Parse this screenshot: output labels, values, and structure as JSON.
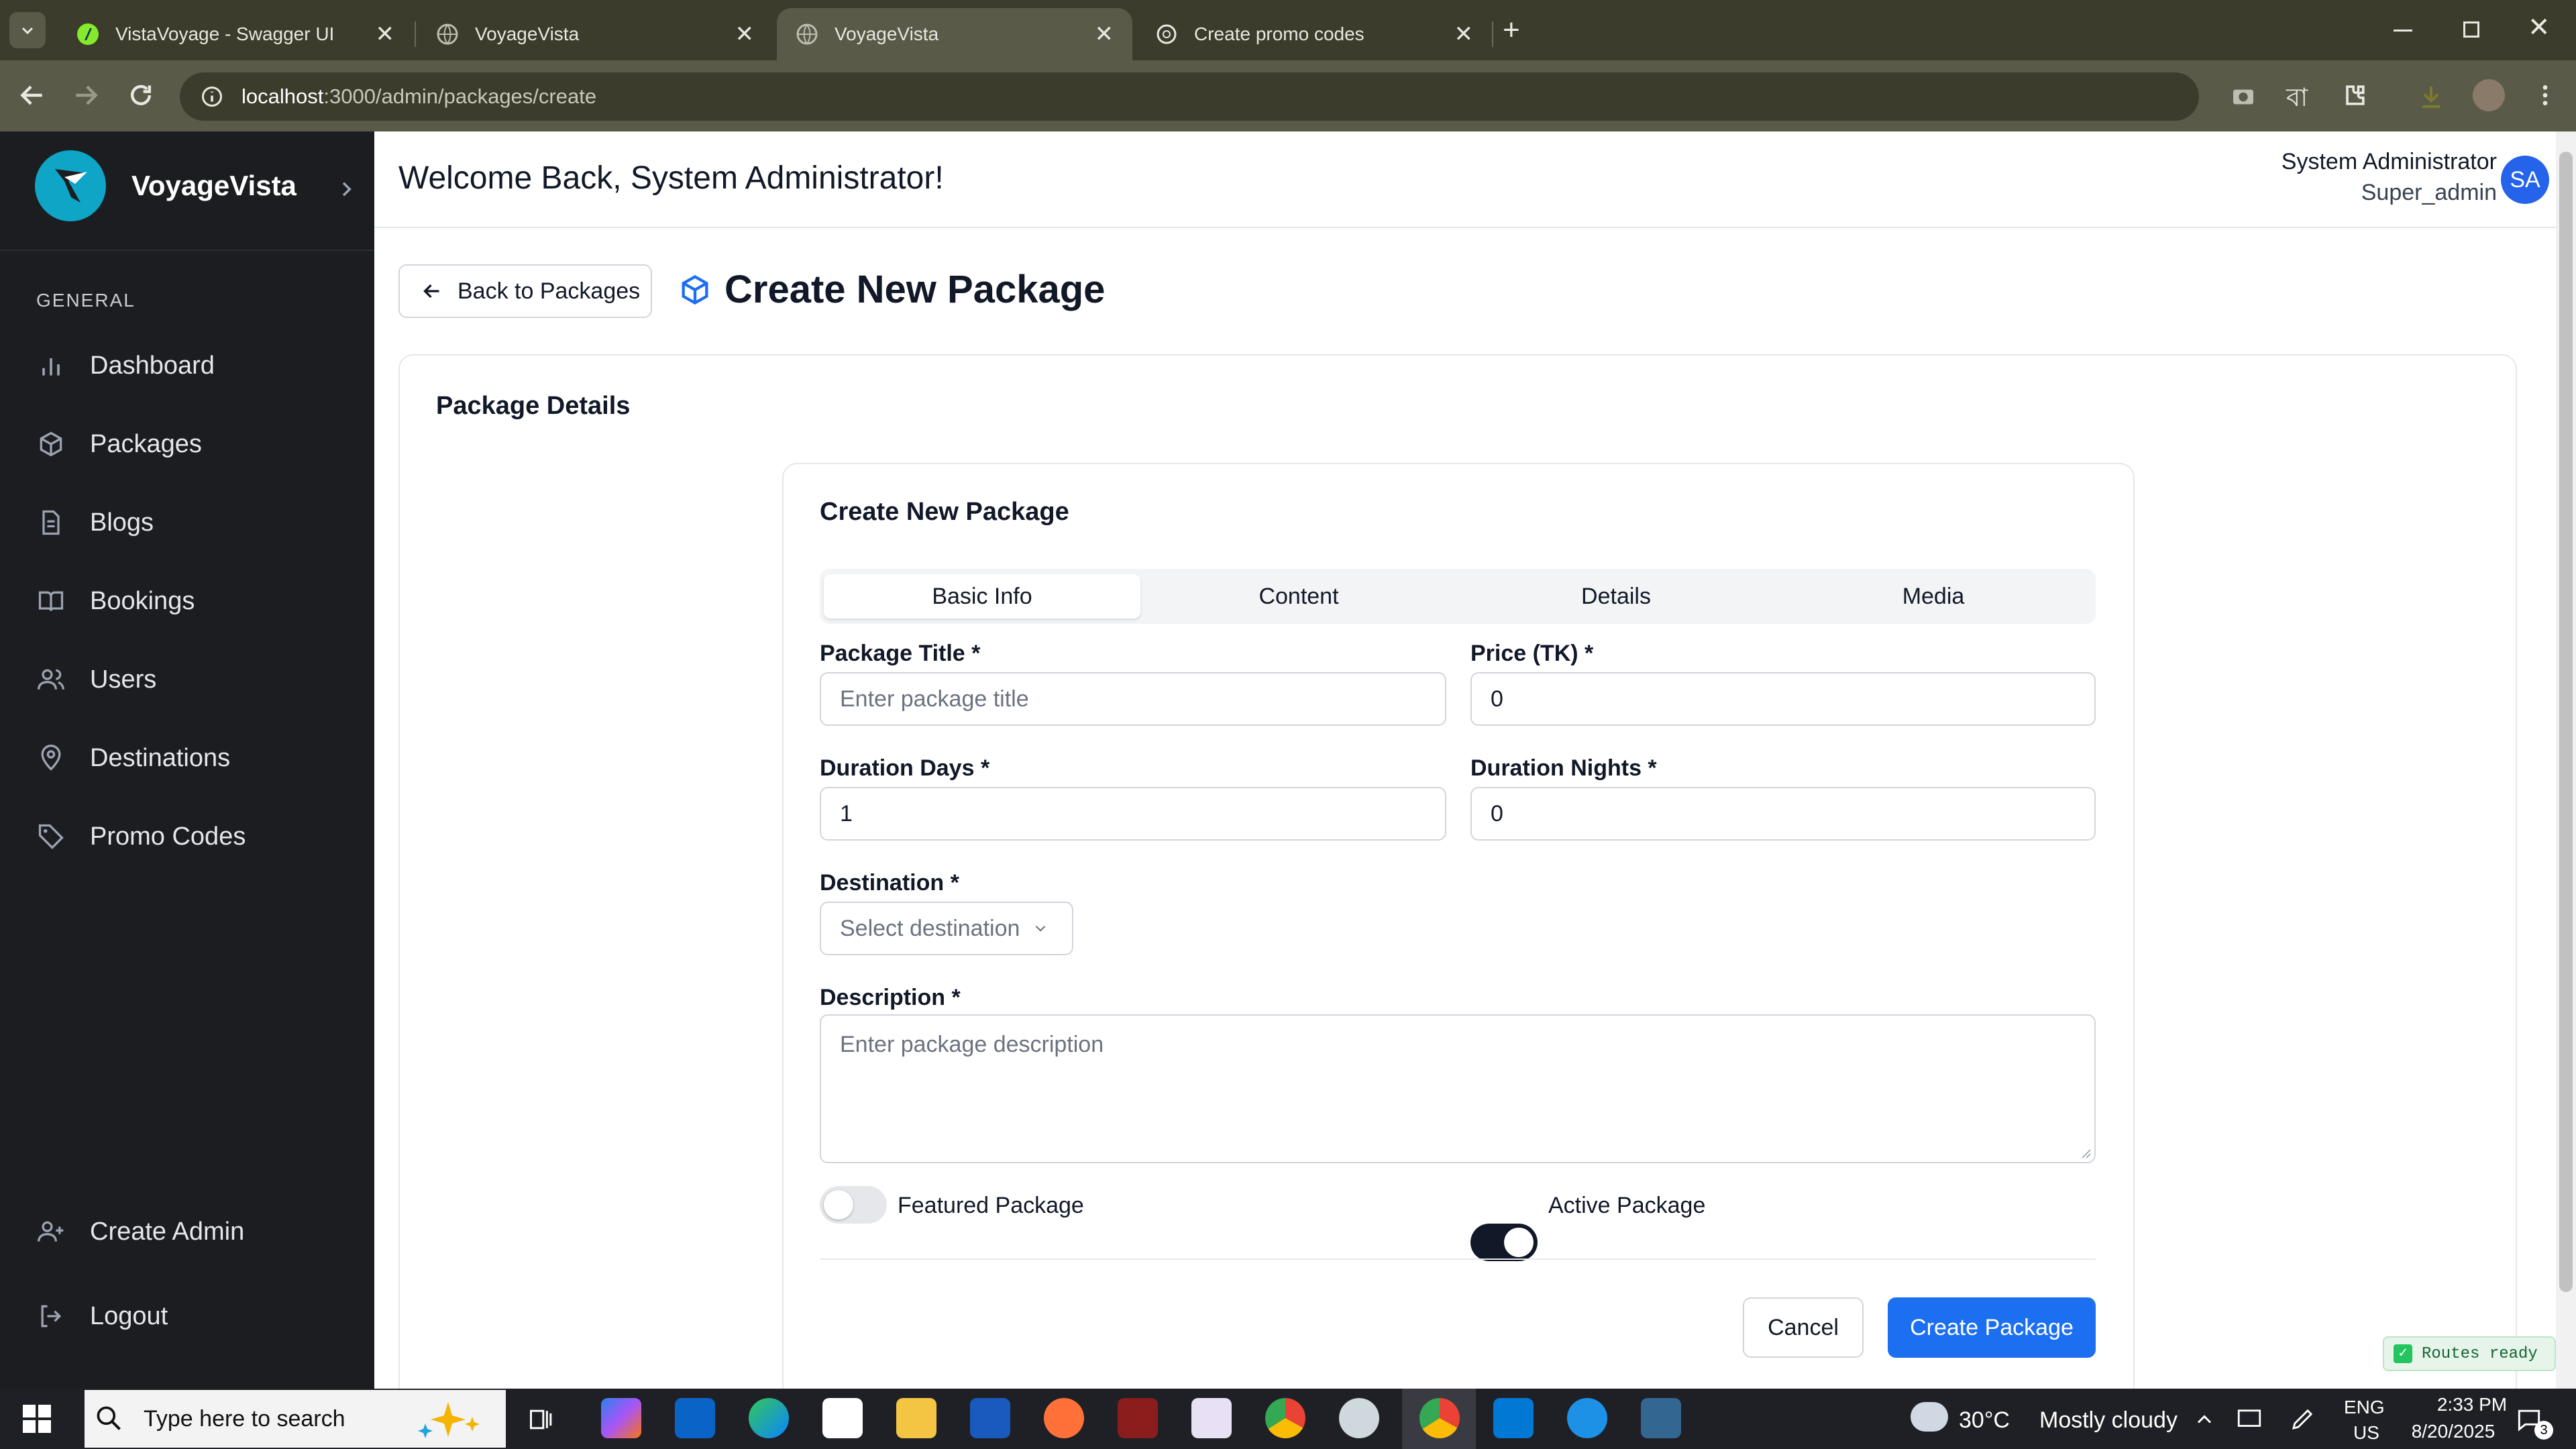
{
  "browser": {
    "tabs": [
      {
        "title": "VistaVoyage - Swagger UI",
        "active": false
      },
      {
        "title": "VoyageVista",
        "active": false
      },
      {
        "title": "VoyageVista",
        "active": true
      },
      {
        "title": "Create promo codes",
        "active": false
      }
    ],
    "new_tab": "+",
    "url_host": "localhost",
    "url_rest": ":3000/admin/packages/create",
    "window_controls": [
      "minimize-icon",
      "restore-icon",
      "close-icon"
    ]
  },
  "sidebar": {
    "brand": "VoyageVista",
    "section": "GENERAL",
    "items": [
      {
        "label": "Dashboard",
        "icon": "bar-chart-icon"
      },
      {
        "label": "Packages",
        "icon": "package-icon"
      },
      {
        "label": "Blogs",
        "icon": "document-icon"
      },
      {
        "label": "Bookings",
        "icon": "book-icon"
      },
      {
        "label": "Users",
        "icon": "users-icon"
      },
      {
        "label": "Destinations",
        "icon": "map-pin-icon"
      },
      {
        "label": "Promo Codes",
        "icon": "tag-icon"
      }
    ],
    "bottom": [
      {
        "label": "Create Admin",
        "icon": "user-plus-icon"
      },
      {
        "label": "Logout",
        "icon": "logout-icon"
      }
    ]
  },
  "header": {
    "welcome": "Welcome Back, System Administrator!",
    "user_name": "System Administrator",
    "user_role": "Super_admin",
    "avatar_initials": "SA"
  },
  "page": {
    "back_label": "Back to Packages",
    "title": "Create New Package",
    "section_title": "Package Details",
    "form_title": "Create New Package",
    "tabs": [
      "Basic Info",
      "Content",
      "Details",
      "Media"
    ],
    "selected_tab": "Basic Info",
    "fields": {
      "title": {
        "label": "Package Title *",
        "placeholder": "Enter package title",
        "value": ""
      },
      "price": {
        "label": "Price (TK) *",
        "value": "0"
      },
      "days": {
        "label": "Duration Days *",
        "value": "1"
      },
      "nights": {
        "label": "Duration Nights *",
        "value": "0"
      },
      "destination": {
        "label": "Destination *",
        "placeholder": "Select destination"
      },
      "description": {
        "label": "Description *",
        "placeholder": "Enter package description"
      }
    },
    "toggles": {
      "featured": {
        "label": "Featured Package",
        "on": false
      },
      "active": {
        "label": "Active Package",
        "on": true
      }
    },
    "cancel_label": "Cancel",
    "create_label": "Create Package"
  },
  "routes_badge": "Routes ready",
  "taskbar": {
    "search_placeholder": "Type here to search",
    "weather_temp": "30°C",
    "weather_text": "Mostly cloudy",
    "lang_top": "ENG",
    "lang_bottom": "US",
    "time": "2:33 PM",
    "date": "8/20/2025",
    "notification_count": "3"
  },
  "colors": {
    "sidebar_bg": "#1b1d21",
    "primary": "#1d6ff2",
    "avatar": "#2563eb",
    "browser_frame": "#3c3c2c"
  }
}
